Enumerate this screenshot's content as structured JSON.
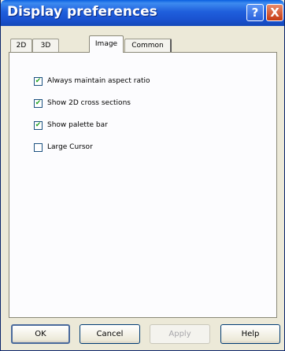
{
  "window": {
    "title": "Display preferences",
    "help_glyph": "?",
    "close_glyph": "X"
  },
  "tabs": [
    {
      "label": "2D",
      "active": false
    },
    {
      "label": "3D",
      "active": false
    },
    {
      "label": "Image",
      "active": true
    },
    {
      "label": "Common",
      "active": false
    }
  ],
  "options": [
    {
      "label": "Always maintain aspect ratio",
      "checked": true
    },
    {
      "label": "Show 2D cross sections",
      "checked": true
    },
    {
      "label": "Show palette bar",
      "checked": true
    },
    {
      "label": "Large Cursor",
      "checked": false
    }
  ],
  "buttons": {
    "ok": "OK",
    "cancel": "Cancel",
    "apply": "Apply",
    "help": "Help"
  },
  "check_glyph": "✔"
}
